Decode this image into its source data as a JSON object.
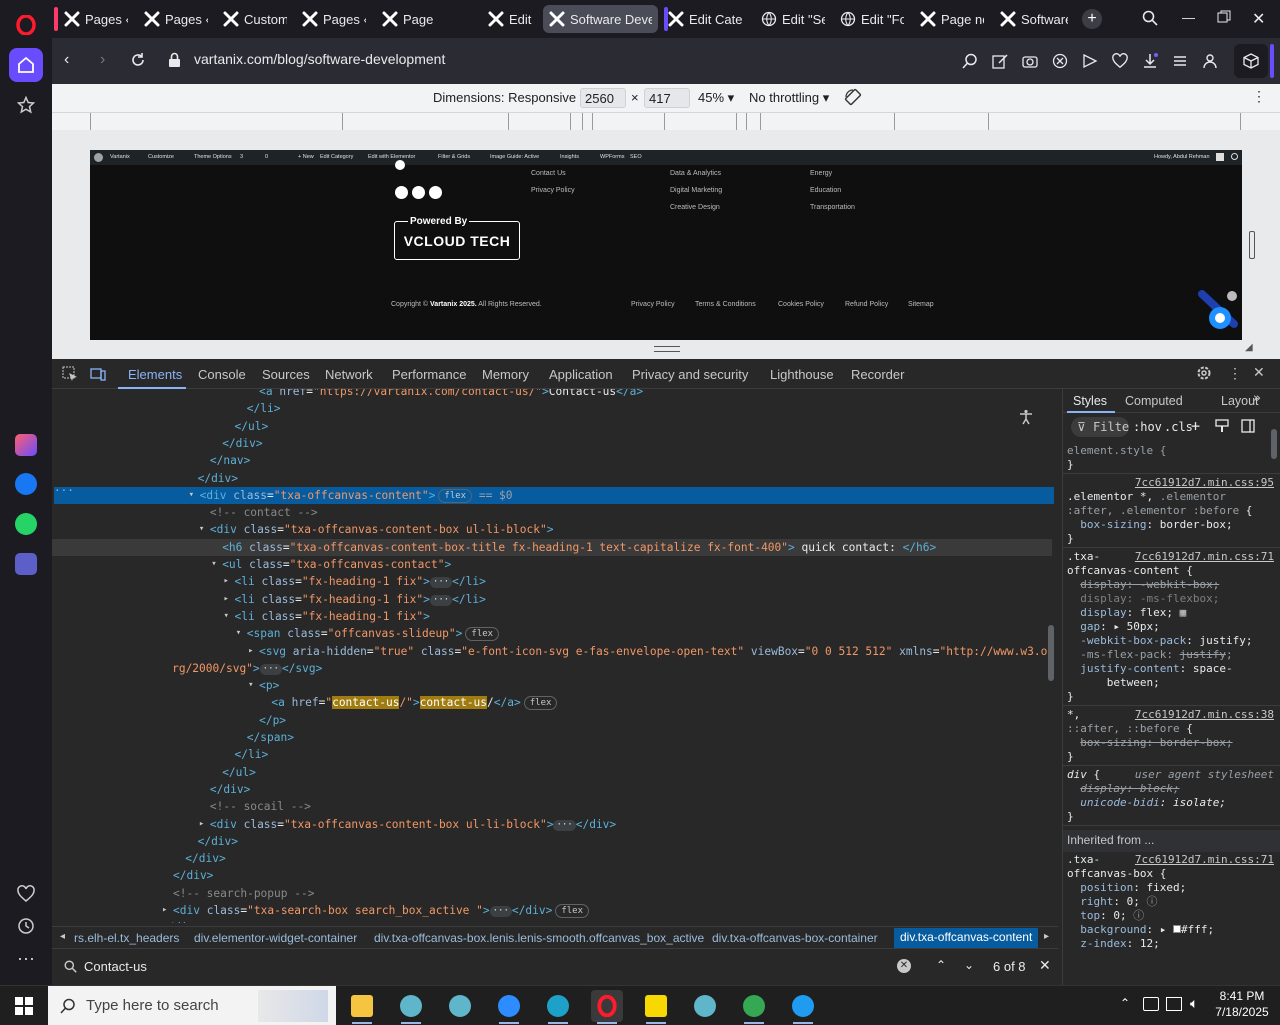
{
  "browser": {
    "tabs": [
      {
        "label": "Pages ‹ V",
        "icon": "wordpress-x-icon"
      },
      {
        "label": "Pages ‹ V",
        "icon": "wordpress-x-icon"
      },
      {
        "label": "Customiz",
        "icon": "wordpress-x-icon"
      },
      {
        "label": "Pages ‹ V",
        "icon": "wordpress-x-icon"
      },
      {
        "label": "Page not",
        "icon": "wordpress-x-icon"
      },
      {
        "label": "Edit \"Foo",
        "icon": "wordpress-x-icon"
      },
      {
        "label": "Software Develo",
        "icon": "wordpress-x-icon",
        "active": true
      },
      {
        "label": "Edit Cate",
        "icon": "wordpress-x-icon"
      },
      {
        "label": "Edit \"Ser",
        "icon": "globe-icon"
      },
      {
        "label": "Edit \"Foo",
        "icon": "globe-icon"
      },
      {
        "label": "Page not",
        "icon": "wordpress-x-icon"
      },
      {
        "label": "Software",
        "icon": "wordpress-x-icon"
      }
    ],
    "url": "vartanix.com/blog/software-development",
    "accent": "#ff1b2d"
  },
  "device_toolbar": {
    "dimensions_label": "Dimensions: Responsive",
    "width": "2560",
    "times": "×",
    "height": "417",
    "zoom": "45%",
    "throttling": "No throttling"
  },
  "site": {
    "wpbar": [
      "Vartanix",
      "Customize",
      "Theme Options",
      "3",
      "0",
      "+ New",
      "Edit Category",
      "Edit with Elementor",
      "Filter & Grids",
      "Image Guide: Active",
      "Insights",
      "WPForms",
      "SEO"
    ],
    "howdy": "Howdy, Abdul Rehman",
    "footer_col1": [
      "Contact Us",
      "Privacy Policy"
    ],
    "footer_col2": [
      "Data & Analytics",
      "Digital Marketing",
      "Creative Design"
    ],
    "footer_col3": [
      "Energy",
      "Education",
      "Transportation"
    ],
    "powered_by": "Powered By",
    "brand": "VCLOUD TECH",
    "copyright_pre": "Copyright ©",
    "copyright_brand": "Vartanix 2025.",
    "copyright_post": "All Rights Reserved.",
    "legal_links": [
      "Privacy Policy",
      "Terms & Conditions",
      "Cookies Policy",
      "Refund Policy",
      "Sitemap"
    ]
  },
  "devtools": {
    "tabs": [
      "Elements",
      "Console",
      "Sources",
      "Network",
      "Performance",
      "Memory",
      "Application",
      "Privacy and security",
      "Lighthouse",
      "Recorder"
    ],
    "styles_tabs": [
      "Styles",
      "Computed",
      "Layout"
    ],
    "filter_placeholder": "Filter",
    "hov": ":hov",
    "cls": ".cls",
    "breadcrumbs": [
      "rs.elh-el.tx_headers",
      "div.elementor-widget-container",
      "div.txa-offcanvas-box.lenis.lenis-smooth.offcanvas_box_active",
      "div.txa-offcanvas-box-container",
      "div.txa-offcanvas-content"
    ],
    "search_value": "Contact-us",
    "search_count": "6 of 8"
  },
  "dom_lines": [
    {
      "indent": 17,
      "html": "<span class='tag'>&lt;a</span> <span class='an'>href</span>=<span class='av'>\"https://vartanix.com/contact-us/\"</span><span class='tag'>&gt;</span>Contact-us<span class='tag'>&lt;/a&gt;</span>"
    },
    {
      "indent": 16,
      "html": "<span class='tag'>&lt;/li&gt;</span>"
    },
    {
      "indent": 15,
      "html": "<span class='tag'>&lt;/ul&gt;</span>"
    },
    {
      "indent": 14,
      "html": "<span class='tag'>&lt;/div&gt;</span>"
    },
    {
      "indent": 13,
      "html": "<span class='tag'>&lt;/nav&gt;</span>"
    },
    {
      "indent": 12,
      "html": "<span class='tag'>&lt;/div&gt;</span>"
    },
    {
      "indent": 12,
      "arrow": "▾",
      "sel": true,
      "html": "<span class='tag'>&lt;div</span> <span class='an'>class</span>=<span class='av'>\"txa-offcanvas-content\"</span><span class='tag'>&gt;</span><span class='pill'>flex</span> <span class='gray'>== $0</span>"
    },
    {
      "indent": 13,
      "html": "<span class='cm'>&lt;!-- contact --&gt;</span>"
    },
    {
      "indent": 13,
      "arrow": "▾",
      "html": "<span class='tag'>&lt;div</span> <span class='an'>class</span>=<span class='av'>\"txa-offcanvas-content-box  ul-li-block\"</span><span class='tag'>&gt;</span>"
    },
    {
      "indent": 14,
      "hov": true,
      "html": "<span class='tag'>&lt;h6</span> <span class='an'>class</span>=<span class='av'>\"txa-offcanvas-content-box-title fx-heading-1 text-capitalize fx-font-400\"</span><span class='tag'>&gt;</span> quick contact: <span class='tag'>&lt;/h6&gt;</span>"
    },
    {
      "indent": 14,
      "arrow": "▾",
      "html": "<span class='tag'>&lt;ul</span> <span class='an'>class</span>=<span class='av'>\"txa-offcanvas-contact\"</span><span class='tag'>&gt;</span>"
    },
    {
      "indent": 15,
      "arrow": "▸",
      "html": "<span class='tag'>&lt;li</span> <span class='an'>class</span>=<span class='av'>\"fx-heading-1 fix\"</span><span class='tag'>&gt;</span><span class='dots'>···</span><span class='tag'>&lt;/li&gt;</span>"
    },
    {
      "indent": 15,
      "arrow": "▸",
      "html": "<span class='tag'>&lt;li</span> <span class='an'>class</span>=<span class='av'>\"fx-heading-1 fix\"</span><span class='tag'>&gt;</span><span class='dots'>···</span><span class='tag'>&lt;/li&gt;</span>"
    },
    {
      "indent": 15,
      "arrow": "▾",
      "html": "<span class='tag'>&lt;li</span> <span class='an'>class</span>=<span class='av'>\"fx-heading-1 fix\"</span><span class='tag'>&gt;</span>"
    },
    {
      "indent": 16,
      "arrow": "▾",
      "html": "<span class='tag'>&lt;span</span> <span class='an'>class</span>=<span class='av'>\"offcanvas-slideup\"</span><span class='tag'>&gt;</span><span class='pill'>flex</span>"
    },
    {
      "indent": 17,
      "arrow": "▸",
      "html": "<span class='tag'>&lt;svg</span> <span class='an'>aria-hidden</span>=<span class='av'>\"true\"</span> <span class='an'>class</span>=<span class='av'>\"e-font-icon-svg e-fas-envelope-open-text\"</span> <span class='an'>viewBox</span>=<span class='av'>\"0 0 512 512\"</span> <span class='an'>xmlns</span>=<span class='av'>\"http://www.w3.o</span>"
    },
    {
      "indent": 17,
      "cont": true,
      "html": "<span class='av'>rg/2000/svg\"</span><span class='tag'>&gt;</span><span class='dots'>···</span><span class='tag'>&lt;/svg&gt;</span>"
    },
    {
      "indent": 17,
      "arrow": "▾",
      "html": "<span class='tag'>&lt;p&gt;</span>"
    },
    {
      "indent": 18,
      "html": "<span class='tag'>&lt;a</span> <span class='an'>href</span>=<span class='av'>\"<span class='hl'>contact-us</span>/\"</span><span class='tag'>&gt;</span><span class='hl'>contact-us</span>/<span class='tag'>&lt;/a&gt;</span><span class='pill'>flex</span>"
    },
    {
      "indent": 17,
      "html": "<span class='tag'>&lt;/p&gt;</span>"
    },
    {
      "indent": 16,
      "html": "<span class='tag'>&lt;/span&gt;</span>"
    },
    {
      "indent": 15,
      "html": "<span class='tag'>&lt;/li&gt;</span>"
    },
    {
      "indent": 14,
      "html": "<span class='tag'>&lt;/ul&gt;</span>"
    },
    {
      "indent": 13,
      "html": "<span class='tag'>&lt;/div&gt;</span>"
    },
    {
      "indent": 13,
      "html": "<span class='cm'>&lt;!-- socail --&gt;</span>"
    },
    {
      "indent": 13,
      "arrow": "▸",
      "html": "<span class='tag'>&lt;div</span> <span class='an'>class</span>=<span class='av'>\"txa-offcanvas-content-box ul-li-block\"</span><span class='tag'>&gt;</span><span class='dots'>···</span><span class='tag'>&lt;/div&gt;</span>"
    },
    {
      "indent": 12,
      "html": "<span class='tag'>&lt;/div&gt;</span>"
    },
    {
      "indent": 11,
      "html": "<span class='tag'>&lt;/div&gt;</span>"
    },
    {
      "indent": 10,
      "html": "<span class='tag'>&lt;/div&gt;</span>"
    },
    {
      "indent": 10,
      "html": "<span class='cm'>&lt;!-- search-popup --&gt;</span>"
    },
    {
      "indent": 10,
      "arrow": "▸",
      "html": "<span class='tag'>&lt;div</span> <span class='an'>class</span>=<span class='av'>\"txa-search-box search_box_active \"</span><span class='tag'>&gt;</span><span class='dots'>···</span><span class='tag'>&lt;/div&gt;</span><span class='pill'>flex</span>"
    },
    {
      "indent": 9,
      "html": "<span class='tag'>&lt;/div&gt;</span>"
    }
  ],
  "style_lines": [
    {
      "html": "<span class='gray'>element.style {</span>"
    },
    {
      "html": "}"
    },
    {
      "src": "7cc61912d7.min.css:95"
    },
    {
      "html": ".elementor *, <span class='gray'>.elementor</span>"
    },
    {
      "html": "<span class='gray'>:after, .elementor :before</span> {"
    },
    {
      "html": "&nbsp;&nbsp;<span class='sp'>box-sizing</span>: border-box;"
    },
    {
      "html": "}"
    },
    {
      "html": ".txa-",
      "src": "7cc61912d7.min.css:71"
    },
    {
      "html": "offcanvas-content {"
    },
    {
      "html": "&nbsp;&nbsp;<span class='strk'>display: -webkit-box;</span>"
    },
    {
      "html": "&nbsp;&nbsp;<span class='strk' style='text-decoration:none;color:#7f7f7f'>display: -ms-flexbox;</span>"
    },
    {
      "html": "&nbsp;&nbsp;<span class='sp'>display</span>: flex;<span style='color:#c8c8c8'> ▦</span>"
    },
    {
      "html": "&nbsp;&nbsp;<span class='sp'>gap</span>: ▸ 50px;"
    },
    {
      "html": "&nbsp;&nbsp;<span class='sp'>-webkit-box-pack</span>: justify;"
    },
    {
      "html": "&nbsp;&nbsp;<span class='gray'>-ms-flex-pack: <s>justify</s>;</span>"
    },
    {
      "html": "&nbsp;&nbsp;<span class='sp'>justify-content</span>: space-"
    },
    {
      "html": "&nbsp;&nbsp;&nbsp;&nbsp;&nbsp;&nbsp;between;"
    },
    {
      "html": "}"
    },
    {
      "html": "*,",
      "src": "7cc61912d7.min.css:38"
    },
    {
      "html": "<span class='gray'>::after, ::before</span> {"
    },
    {
      "html": "&nbsp;&nbsp;<span class='strk'>box-sizing: border-box;</span>"
    },
    {
      "html": "}"
    },
    {
      "html": "<i>div</i> {",
      "agent": "user agent stylesheet"
    },
    {
      "html": "&nbsp;&nbsp;<span class='strk'><i>display: block;</i></span>"
    },
    {
      "html": "&nbsp;&nbsp;<i><span class='sp'>unicode-bidi</span>: isolate;</i>"
    },
    {
      "html": "}"
    },
    {
      "inherit": "Inherited from ..."
    },
    {
      "html": ".txa-",
      "src": "7cc61912d7.min.css:71"
    },
    {
      "html": "offcanvas-box {"
    },
    {
      "html": "&nbsp;&nbsp;<span class='sp'>position</span>: fixed;"
    },
    {
      "html": "&nbsp;&nbsp;<span class='sp'>right</span>: 0;<span class='gray'> ⓘ</span>"
    },
    {
      "html": "&nbsp;&nbsp;<span class='sp'>top</span>: 0;<span class='gray'> ⓘ</span>"
    },
    {
      "html": "&nbsp;&nbsp;<span class='sp'>background</span>: ▸ <span style='display:inline-block;width:8px;height:8px;background:#fff;border:1px solid #888'></span>#fff;"
    },
    {
      "html": "&nbsp;&nbsp;<span class='sp'>z-index</span>: 12;"
    }
  ],
  "taskbar": {
    "search_placeholder": "Type here to search",
    "time": "8:41 PM",
    "date": "7/18/2025",
    "apps": [
      "file-explorer-icon",
      "app-icon",
      "app-icon",
      "zoom-icon",
      "edge-icon",
      "opera-icon",
      "sticky-notes-icon",
      "app-icon",
      "chrome-icon",
      "vscode-icon"
    ]
  }
}
